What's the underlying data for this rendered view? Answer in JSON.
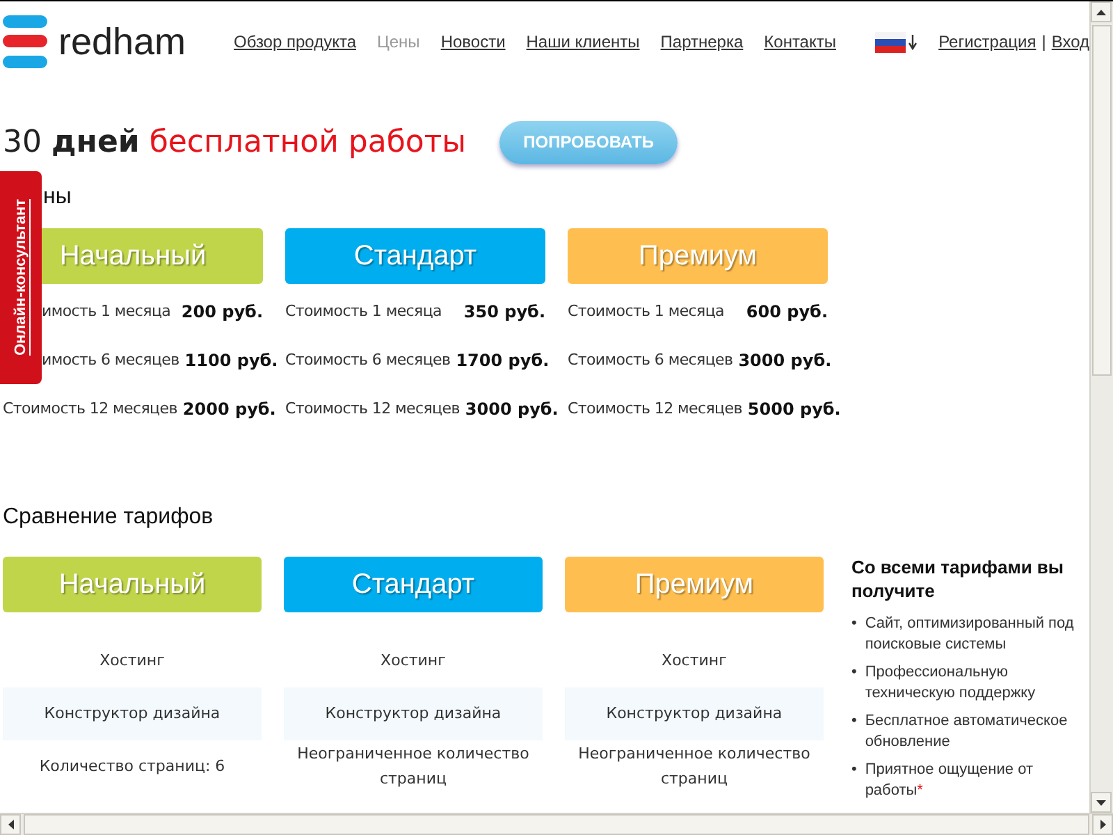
{
  "header": {
    "logo": "redham",
    "nav": [
      {
        "label": "Обзор продукта",
        "selected": false
      },
      {
        "label": "Цены",
        "selected": true
      },
      {
        "label": "Новости",
        "selected": false
      },
      {
        "label": "Наши клиенты",
        "selected": false
      },
      {
        "label": "Партнерка",
        "selected": false
      },
      {
        "label": "Контакты",
        "selected": false
      }
    ],
    "auth": {
      "register": "Регистрация",
      "separator": "|",
      "login": "Вход"
    }
  },
  "hero": {
    "number": "30",
    "bold": "дней",
    "accent": "бесплатной работы",
    "button": "ПОПРОБОВАТЬ"
  },
  "consultant_tab": "Онлайн-консультант",
  "prices": {
    "heading": "ны",
    "plans": [
      {
        "name": "Начальный",
        "color": "#c1d54b",
        "rows": [
          {
            "label": "имость 1 месяца",
            "price": "200 руб."
          },
          {
            "label": "имость 6 месяцев",
            "price": "1100 руб."
          },
          {
            "label": "Стоимость 12 месяцев",
            "price": "2000 руб."
          }
        ]
      },
      {
        "name": "Стандарт",
        "color": "#00aeef",
        "rows": [
          {
            "label": "Стоимость 1 месяца",
            "price": "350 руб."
          },
          {
            "label": "Стоимость 6 месяцев",
            "price": "1700 руб."
          },
          {
            "label": "Стоимость 12 месяцев",
            "price": "3000 руб."
          }
        ]
      },
      {
        "name": "Премиум",
        "color": "#ffbf50",
        "rows": [
          {
            "label": "Стоимость 1 месяца",
            "price": "600 руб."
          },
          {
            "label": "Стоимость 6 месяцев",
            "price": "3000 руб."
          },
          {
            "label": "Стоимость 12 месяцев",
            "price": "5000 руб."
          }
        ]
      }
    ]
  },
  "compare": {
    "heading": "Сравнение тарифов",
    "plans": [
      {
        "name": "Начальный",
        "color": "#c1d54b",
        "features": [
          "Хостинг",
          "Конструктор дизайна",
          "Количество страниц: 6"
        ]
      },
      {
        "name": "Стандарт",
        "color": "#00aeef",
        "features": [
          "Хостинг",
          "Конструктор дизайна",
          "Неограниченное количество страниц"
        ]
      },
      {
        "name": "Премиум",
        "color": "#ffbf50",
        "features": [
          "Хостинг",
          "Конструктор дизайна",
          "Неограниченное количество страниц"
        ]
      }
    ],
    "benefits": {
      "title": "Со всеми тарифами вы получите",
      "bullet": "•",
      "items": [
        {
          "text": "Сайт, оптимизированный под поисковые системы"
        },
        {
          "text": "Профессиональную техническую поддержку"
        },
        {
          "text": "Бесплатное автоматическое обновление"
        },
        {
          "text": "Приятное ощущение от работы",
          "note": "*"
        }
      ]
    }
  }
}
